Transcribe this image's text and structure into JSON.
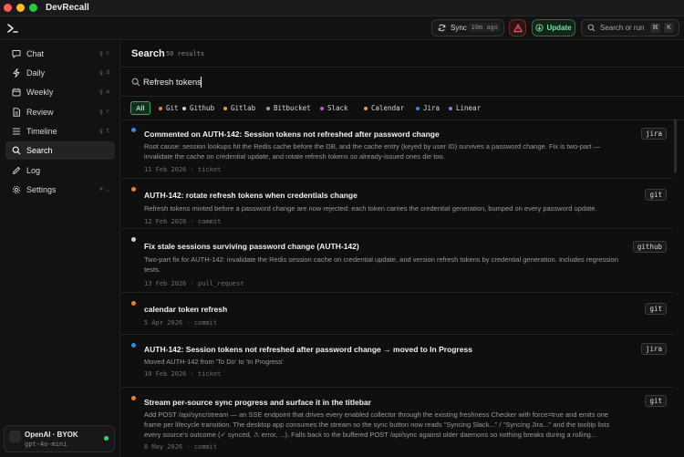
{
  "window": {
    "title": "DevRecall"
  },
  "header": {
    "sync_label": "Sync",
    "sync_ago": "10m ago",
    "update_label": "Update",
    "search_placeholder": "Search or run",
    "kbd1": "⌘",
    "kbd2": "K"
  },
  "sidebar": {
    "items": [
      {
        "label": "Chat",
        "shortcut": "g c"
      },
      {
        "label": "Daily",
        "shortcut": "g d"
      },
      {
        "label": "Weekly",
        "shortcut": "g w"
      },
      {
        "label": "Review",
        "shortcut": "g r"
      },
      {
        "label": "Timeline",
        "shortcut": "g t"
      },
      {
        "label": "Search",
        "shortcut": ""
      },
      {
        "label": "Log",
        "shortcut": ""
      },
      {
        "label": "Settings",
        "shortcut": "⌘ ,"
      }
    ],
    "active": "Search",
    "footer": {
      "title": "OpenAI · BYOK",
      "model": "gpt-4o-mini"
    }
  },
  "main": {
    "title": "Search",
    "count": "50 results",
    "query": "Refresh tokens",
    "filters": [
      {
        "label": "All",
        "color": ""
      },
      {
        "label": "Git",
        "color": "#f07a3a"
      },
      {
        "label": "Github",
        "color": "#d0d0d0"
      },
      {
        "label": "Gitlab",
        "color": "#f0913a"
      },
      {
        "label": "Bitbucket",
        "color": "#9a9a9a"
      },
      {
        "label": "Slack",
        "color": "#c05ad0"
      },
      {
        "label": "Calendar",
        "color": "#e8a040"
      },
      {
        "label": "Jira",
        "color": "#3a86e0"
      },
      {
        "label": "Linear",
        "color": "#8a7ae0"
      }
    ],
    "results": [
      {
        "title": "Commented on AUTH-142: Session tokens not refreshed after password change",
        "snippet": "Root cause: session lookups hit the Redis cache before the DB, and the cache entry (keyed by user ID) survives a password change. Fix is two-part — invalidate the cache on credential update, and rotate refresh tokens so already-issued ones die too.",
        "meta": "11 Feb 2026 · ticket",
        "badge": "jira",
        "dot": "#3a86e0"
      },
      {
        "title": "AUTH-142: rotate refresh tokens when credentials change",
        "snippet": "Refresh tokens minted before a password change are now rejected: each token carries the credential generation, bumped on every password update.",
        "meta": "12 Feb 2026 · commit",
        "badge": "git",
        "dot": "#f07a3a"
      },
      {
        "title": "Fix stale sessions surviving password change (AUTH-142)",
        "snippet": "Two-part fix for AUTH-142: invalidate the Redis session cache on credential update, and version refresh tokens by credential generation. Includes regression tests.",
        "meta": "13 Feb 2026 · pull_request",
        "badge": "github",
        "dot": "#d0d0d0"
      },
      {
        "title": "calendar token refresh",
        "snippet": "",
        "meta": "5 Apr 2026 · commit",
        "badge": "git",
        "dot": "#f07a3a"
      },
      {
        "title": "AUTH-142: Session tokens not refreshed after password change → moved to In Progress",
        "snippet": "Moved AUTH-142 from 'To Do' to 'In Progress'",
        "meta": "10 Feb 2026 · ticket",
        "badge": "jira",
        "dot": "#3a86e0"
      },
      {
        "title": "Stream per-source sync progress and surface it in the titlebar",
        "snippet": "Add POST /api/sync/stream — an SSE endpoint that drives every enabled collector through the existing freshness Checker with force=true and emits one frame per lifecycle transition. The desktop app consumes the stream so the sync button now reads \"Syncing Slack...\" / \"Syncing Jira...\" and the tooltip lists every source's outcome (✓ synced, ⚠ error, ...). Falls back to the buffered POST /api/sync against older daemons so nothing breaks during a rolling...",
        "meta": "8 May 2026 · commit",
        "badge": "git",
        "dot": "#f07a3a"
      }
    ]
  }
}
